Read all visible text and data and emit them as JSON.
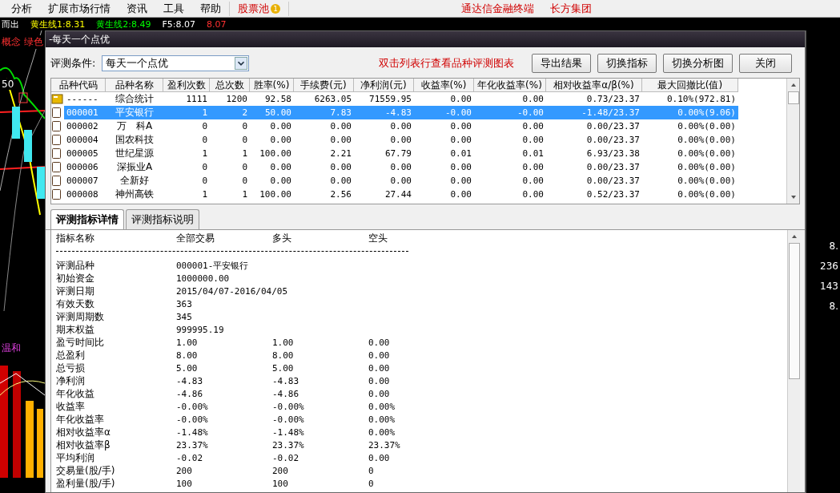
{
  "menu": [
    {
      "kind": "menu",
      "label": "分析"
    },
    {
      "kind": "menu",
      "label": "扩展市场行情"
    },
    {
      "kind": "menu",
      "label": "资讯"
    },
    {
      "kind": "menu",
      "label": "工具"
    },
    {
      "kind": "menu",
      "label": "帮助"
    },
    {
      "kind": "pool",
      "label": "股票池",
      "badge": "1"
    }
  ],
  "menu_links": [
    "通达信金融终端",
    "长方集团"
  ],
  "ticker": [
    "而出",
    "黄生线1:8.31",
    "黄生线2:8.49",
    "F5:8.07",
    "8.07"
  ],
  "chart_labels": {
    "top": "概念 绿色",
    "price": "50",
    "lower": "温和"
  },
  "right_values": [
    "8.",
    "236",
    "143",
    "8."
  ],
  "dialog": {
    "title": "-每天一个点优",
    "condition_label": "评测条件:",
    "condition_value": "每天一个点优",
    "hint": "双击列表行查看品种评测图表",
    "buttons": [
      "导出结果",
      "切换指标",
      "切换分析图",
      "关闭"
    ],
    "table": {
      "columns": [
        "品种代码",
        "品种名称",
        "盈利次数",
        "总次数",
        "胜率(%)",
        "手续费(元)",
        "净利润(元)",
        "收益率(%)",
        "年化收益率(%)",
        "相对收益率α/β(%)",
        "最大回撤比(值)"
      ],
      "rows": [
        {
          "kind": "summary",
          "selected": false,
          "cells": [
            "------",
            "综合统计",
            "1111",
            "1200",
            "92.58",
            "6263.05",
            "71559.95",
            "0.00",
            "0.00",
            "0.73/23.37",
            "0.10%(972.81)"
          ]
        },
        {
          "kind": "stock",
          "selected": true,
          "cells": [
            "000001",
            "平安银行",
            "1",
            "2",
            "50.00",
            "7.83",
            "-4.83",
            "-0.00",
            "-0.00",
            "-1.48/23.37",
            "0.00%(9.06)"
          ]
        },
        {
          "kind": "stock",
          "selected": false,
          "cells": [
            "000002",
            "万　科A",
            "0",
            "0",
            "0.00",
            "0.00",
            "0.00",
            "0.00",
            "0.00",
            "0.00/23.37",
            "0.00%(0.00)"
          ]
        },
        {
          "kind": "stock",
          "selected": false,
          "cells": [
            "000004",
            "国农科技",
            "0",
            "0",
            "0.00",
            "0.00",
            "0.00",
            "0.00",
            "0.00",
            "0.00/23.37",
            "0.00%(0.00)"
          ]
        },
        {
          "kind": "stock",
          "selected": false,
          "cells": [
            "000005",
            "世纪星源",
            "1",
            "1",
            "100.00",
            "2.21",
            "67.79",
            "0.01",
            "0.01",
            "6.93/23.38",
            "0.00%(0.00)"
          ]
        },
        {
          "kind": "stock",
          "selected": false,
          "cells": [
            "000006",
            "深振业A",
            "0",
            "0",
            "0.00",
            "0.00",
            "0.00",
            "0.00",
            "0.00",
            "0.00/23.37",
            "0.00%(0.00)"
          ]
        },
        {
          "kind": "stock",
          "selected": false,
          "cells": [
            "000007",
            "全新好",
            "0",
            "0",
            "0.00",
            "0.00",
            "0.00",
            "0.00",
            "0.00",
            "0.00/23.37",
            "0.00%(0.00)"
          ]
        },
        {
          "kind": "stock",
          "selected": false,
          "cells": [
            "000008",
            "神州高铁",
            "1",
            "1",
            "100.00",
            "2.56",
            "27.44",
            "0.00",
            "0.00",
            "0.52/23.37",
            "0.00%(0.00)"
          ]
        }
      ]
    },
    "tabs": [
      {
        "label": "评测指标详情",
        "selected": true
      },
      {
        "label": "评测指标说明",
        "selected": false
      }
    ],
    "detail": {
      "columns": [
        "指标名称",
        "全部交易",
        "多头",
        "空头"
      ],
      "rows": [
        {
          "label": "评测品种",
          "values": [
            "000001-平安银行"
          ]
        },
        {
          "label": "初始资金",
          "values": [
            "1000000.00"
          ]
        },
        {
          "label": "评测日期",
          "values": [
            "2015/04/07-2016/04/05"
          ]
        },
        {
          "label": "有效天数",
          "values": [
            "363"
          ]
        },
        {
          "label": "评测周期数",
          "values": [
            "345"
          ]
        },
        {
          "label": "期末权益",
          "values": [
            "999995.19"
          ]
        },
        {
          "label": "盈亏时间比",
          "values": [
            "1.00",
            "1.00",
            "0.00"
          ]
        },
        {
          "label": "总盈利",
          "values": [
            "8.00",
            "8.00",
            "0.00"
          ]
        },
        {
          "label": "总亏损",
          "values": [
            "5.00",
            "5.00",
            "0.00"
          ]
        },
        {
          "label": "净利润",
          "values": [
            "-4.83",
            "-4.83",
            "0.00"
          ]
        },
        {
          "label": "年化收益",
          "values": [
            "-4.86",
            "-4.86",
            "0.00"
          ]
        },
        {
          "label": "收益率",
          "values": [
            "-0.00%",
            "-0.00%",
            "0.00%"
          ]
        },
        {
          "label": "年化收益率",
          "values": [
            "-0.00%",
            "-0.00%",
            "0.00%"
          ]
        },
        {
          "label": "相对收益率α",
          "values": [
            "-1.48%",
            "-1.48%",
            "0.00%"
          ]
        },
        {
          "label": "相对收益率β",
          "values": [
            "23.37%",
            "23.37%",
            "23.37%"
          ]
        },
        {
          "label": "平均利润",
          "values": [
            "-0.02",
            "-0.02",
            "0.00"
          ]
        },
        {
          "label": "交易量(股/手)",
          "values": [
            "200",
            "200",
            "0"
          ]
        },
        {
          "label": "盈利量(股/手)",
          "values": [
            "100",
            "100",
            "0"
          ]
        }
      ]
    }
  }
}
